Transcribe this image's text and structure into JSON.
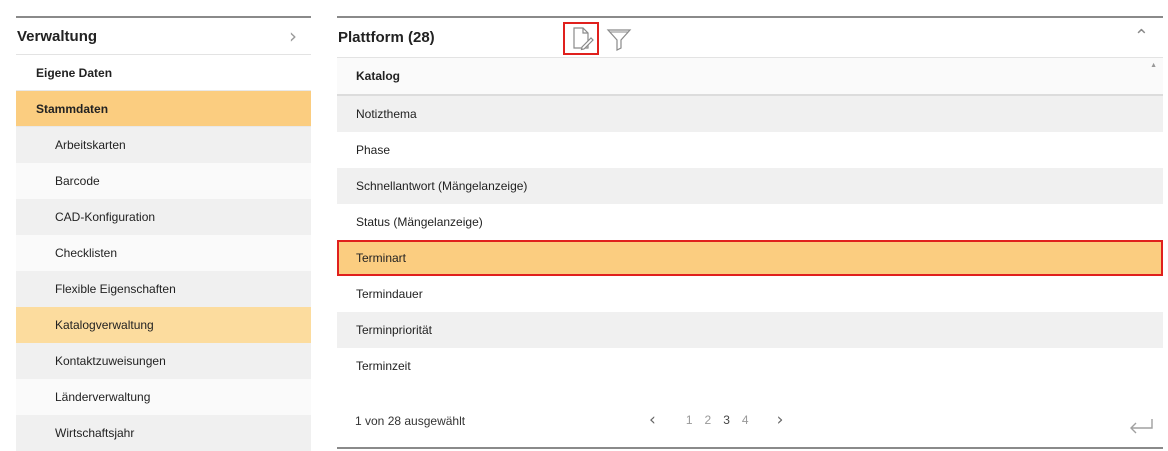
{
  "sidebar": {
    "title": "Verwaltung",
    "sections": [
      {
        "label": "Eigene Daten"
      },
      {
        "label": "Stammdaten"
      }
    ],
    "items": [
      {
        "label": "Arbeitskarten"
      },
      {
        "label": "Barcode"
      },
      {
        "label": "CAD-Konfiguration"
      },
      {
        "label": "Checklisten"
      },
      {
        "label": "Flexible Eigenschaften"
      },
      {
        "label": "Katalogverwaltung"
      },
      {
        "label": "Kontaktzuweisungen"
      },
      {
        "label": "Länderverwaltung"
      },
      {
        "label": "Wirtschaftsjahr"
      }
    ]
  },
  "panel": {
    "title": "Plattform (28)",
    "column_header": "Katalog",
    "rows": [
      {
        "label": "Notizthema"
      },
      {
        "label": "Phase"
      },
      {
        "label": "Schnellantwort (Mängelanzeige)"
      },
      {
        "label": "Status (Mängelanzeige)"
      },
      {
        "label": "Terminart"
      },
      {
        "label": "Termindauer"
      },
      {
        "label": "Terminpriorität"
      },
      {
        "label": "Terminzeit"
      }
    ],
    "status": "1 von 28 ausgewählt",
    "pages": [
      "1",
      "2",
      "3",
      "4"
    ],
    "current_page": "3"
  },
  "icons": {
    "sidebar_chevron": "chevron-right-icon",
    "edit": "document-edit-icon",
    "filter": "filter-icon",
    "collapse": "chevron-up-icon",
    "prev": "chevron-left-icon",
    "next": "chevron-right-icon",
    "return": "return-icon"
  },
  "colors": {
    "accent": "#fbcd80",
    "selected_sidebar_item": "#fcdc9e",
    "highlight_border": "#e0201d",
    "row_alt": "#f0f0f0"
  }
}
